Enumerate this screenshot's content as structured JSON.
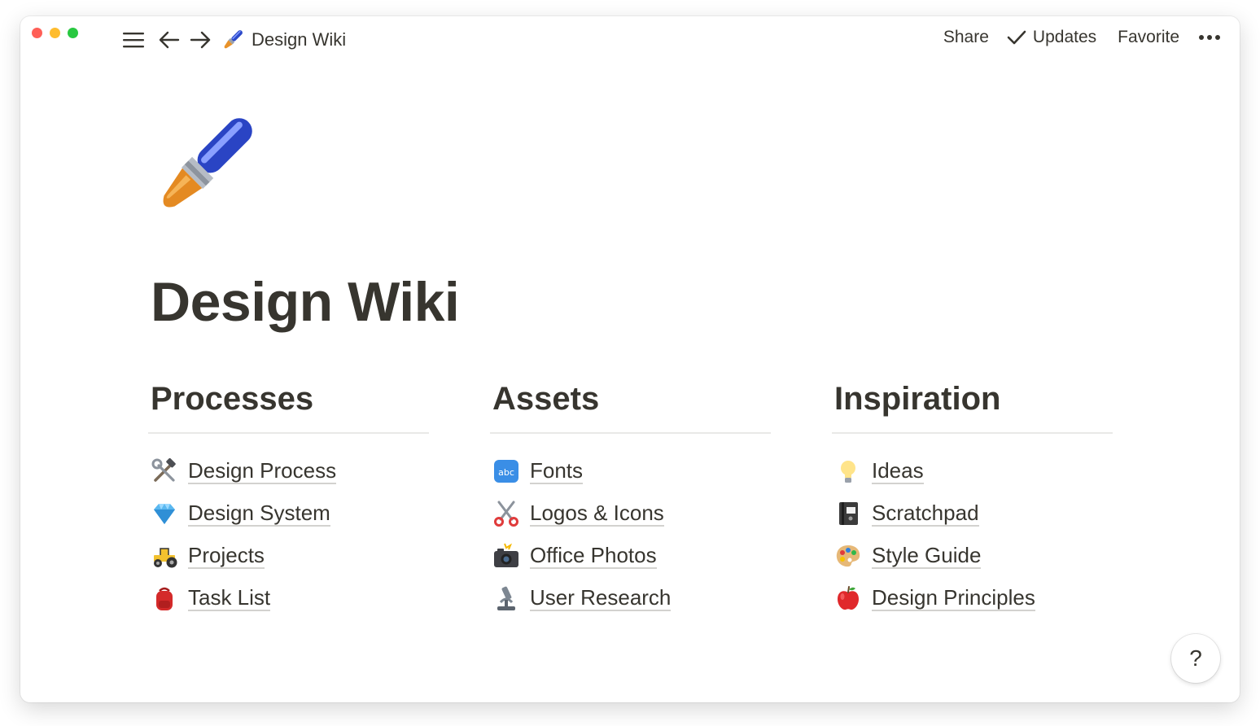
{
  "window": {
    "traffic_lights": {
      "close": "#ff5f57",
      "minimize": "#febc2e",
      "zoom": "#28c840"
    }
  },
  "topbar": {
    "menu_icon": "hamburger-icon",
    "back_icon": "arrow-left-icon",
    "forward_icon": "arrow-right-icon",
    "breadcrumb": {
      "icon": "paintbrush-icon",
      "label": "Design Wiki"
    },
    "share_label": "Share",
    "updates_label": "Updates",
    "favorite_label": "Favorite",
    "more_icon": "more-horizontal-icon"
  },
  "page": {
    "icon": "paintbrush-icon",
    "title": "Design Wiki"
  },
  "columns": [
    {
      "heading": "Processes",
      "links": [
        {
          "icon": "hammer-wrench-icon",
          "label": "Design Process"
        },
        {
          "icon": "gem-icon",
          "label": "Design System"
        },
        {
          "icon": "tractor-icon",
          "label": "Projects"
        },
        {
          "icon": "backpack-icon",
          "label": "Task List"
        }
      ]
    },
    {
      "heading": "Assets",
      "links": [
        {
          "icon": "abc-icon",
          "label": "Fonts"
        },
        {
          "icon": "scissors-icon",
          "label": "Logos & Icons"
        },
        {
          "icon": "camera-flash-icon",
          "label": "Office Photos"
        },
        {
          "icon": "microscope-icon",
          "label": "User Research"
        }
      ]
    },
    {
      "heading": "Inspiration",
      "links": [
        {
          "icon": "lightbulb-icon",
          "label": "Ideas"
        },
        {
          "icon": "notebook-icon",
          "label": "Scratchpad"
        },
        {
          "icon": "palette-icon",
          "label": "Style Guide"
        },
        {
          "icon": "apple-icon",
          "label": "Design Principles"
        }
      ]
    }
  ],
  "help_label": "?"
}
